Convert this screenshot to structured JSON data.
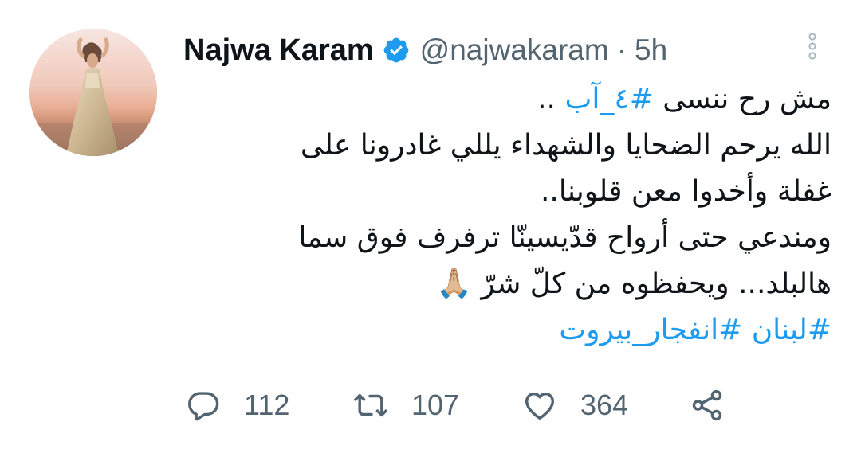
{
  "author": {
    "display_name": "Najwa Karam",
    "handle": "@najwakaram",
    "separator": "·",
    "time": "5h",
    "verified": true
  },
  "tweet": {
    "line1_text": "مش رح ننسى ",
    "line1_hashtag": "#٤_آب",
    "line1_tail": " ..",
    "line2": "الله يرحم الضحايا والشهداء يللي غادرونا على",
    "line3": "غفلة وأخدوا معن قلوبنا..",
    "line4": "ومندعي حتى أرواح قدّيسينّا ترفرف فوق سما",
    "line5": "هالبلد... ويحفظوه من كلّ شرّ 🙏🏼",
    "hashtag_a": "#لبنان",
    "hashtag_b": "#انفجار_بيروت"
  },
  "actions": {
    "replies": "112",
    "retweets": "107",
    "likes": "364"
  },
  "icons": {
    "verified": "verified-badge-icon",
    "more": "more-options-icon",
    "reply": "reply-icon",
    "retweet": "retweet-icon",
    "like": "heart-icon",
    "share": "share-icon"
  },
  "colors": {
    "accent": "#1d9bf0",
    "secondary_text": "#536471",
    "primary_text": "#0f1419"
  }
}
